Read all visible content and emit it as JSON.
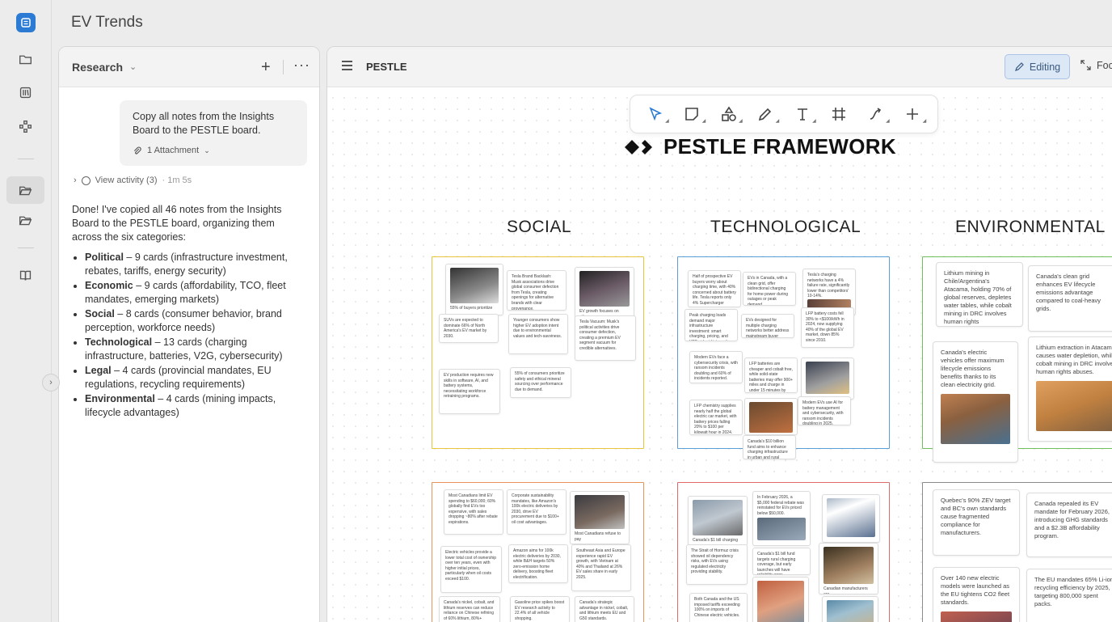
{
  "app": {
    "title": "EV Trends"
  },
  "rail": {
    "icons": [
      "folder-icon",
      "library-icon",
      "flow-icon",
      "folder-open-icon",
      "folder-open-icon",
      "book-icon"
    ]
  },
  "research": {
    "title": "Research",
    "user_message": "Copy all notes from the Insights Board to the PESTLE board.",
    "attachment": "1 Attachment",
    "activity": "View activity (3)",
    "activity_time": "· 1m 5s",
    "reply_intro": "Done! I've copied all 46 notes from the Insights Board to the PESTLE board, organizing them across the six categories:",
    "items": [
      {
        "name": "Political",
        "text": " – 9 cards (infrastructure investment, rebates, tariffs, energy security)"
      },
      {
        "name": "Economic",
        "text": " – 9 cards (affordability, TCO, fleet mandates, emerging markets)"
      },
      {
        "name": "Social",
        "text": " – 8 cards (consumer behavior, brand perception, workforce needs)"
      },
      {
        "name": "Technological",
        "text": " – 13 cards (charging infrastructure, batteries, V2G, cybersecurity)"
      },
      {
        "name": "Legal",
        "text": " – 4 cards (provincial mandates, EU regulations, recycling requirements)"
      },
      {
        "name": "Environmental",
        "text": " – 4 cards (mining impacts, lifecycle advantages)"
      }
    ]
  },
  "canvas": {
    "title": "PESTLE",
    "editing_label": "Editing",
    "focus_label": "Foc",
    "framework_title": "PESTLE FRAMEWORK",
    "categories": [
      "SOCIAL",
      "TECHNOLOGICAL",
      "ENVIRONMENTAL"
    ],
    "colors": {
      "social": "#e8c53a",
      "technological": "#5a9fd8",
      "environmental": "#6fbf5a",
      "economic": "#e8935a",
      "legal": "#e06a6a",
      "political": "#8a8a8a"
    },
    "social_cards": [
      "55% of buyers prioritize",
      "Tesla Brand Backlash: Musk associations drive global consumer defection from Tesla, creating openings for alternative brands with clear provenance.",
      "EV growth focuses on cities.",
      "SUVs are expected to dominate 66% of North America's EV market by 2030.",
      "Younger consumers show higher EV adoption intent due to environmental values and tech-savviness.",
      "Tesla Vacuum: Musk's political activities drive consumer defection, creating a premium EV segment vacuum for credible alternatives.",
      "EV production requires new skills in software, AI, and battery systems, necessitating workforce retraining programs.",
      "55% of consumers prioritize safety and ethical mineral sourcing over performance due to demand."
    ],
    "tech_cards": [
      "Half of prospective EV buyers worry about charging time, with 40% concerned about battery life. Tesla reports only 4% Supercharger issues versus competitors' 10-14%.",
      "EVs in Canada, with a clean grid, offer bidirectional charging for home power during outages or peak demand.",
      "Tesla's charging networks have a 4% failure rate, significantly lower than competitors' 10-14%.",
      "Peak charging loads demand major infrastructure investment: smart charging, pricing, and V2G aid grid integration.",
      "EVs designed for multiple charging networks better address mainstream buyer needs.",
      "LFP battery costs fell 30% to <$100/kWh in 2024, now supplying 40% of the global EV market, down 85% since 2010.",
      "Modern EVs face a cybersecurity crisis, with ransom incidents doubling and 60% of incidents reported.",
      "LFP batteries are cheaper and cobalt free, while solid-state batteries may offer 900+ miles and charge in under 15 minutes by 2027-2030.",
      "LFP chemistry supplies nearly half the global electric car market, with battery prices falling 20% to $100 per kilowatt hour in 2024.",
      "Modern EVs use AI for battery management and cybersecurity, with ransom incidents doubling in 2025.",
      "Canada's $10 billion fund aims to enhance charging infrastructure in urban and rural areas."
    ],
    "env_cards": [
      "Lithium mining in Chile/Argentina's Atacama, holding 70% of global reserves, depletes water tables, while cobalt mining in DRC involves human rights",
      "Canada's clean grid enhances EV lifecycle emissions advantage compared to coal-heavy grids.",
      "Canada's electric vehicles offer maximum lifecycle emissions benefits thanks to its clean electricity grid.",
      "Lithium extraction in Atacama causes water depletion, while cobalt mining in DRC involves human rights abuses."
    ],
    "econ_cards": [
      "Most Canadians limit EV spending to $60,000; 60% globally find EVs too expensive, with sales dropping ~80% after rebate expirations.",
      "Corporate sustainability mandates, like Amazon's 100k electric deliveries by 2030, drive EV procurement due to $100+ oil cost advantages.",
      "Most Canadians refuse to pay",
      "Electric vehicles provide a lower total cost of ownership over ten years, even with higher initial prices, particularly when oil costs exceed $100.",
      "Amazon aims for 100k electric deliveries by 2030, while B&H targets 50% zero-emission home delivery, boosting fleet electrification.",
      "Southeast Asia and Europe experience rapid EV growth, with Vietnam at 40% and Thailand at 26% EV sales share in early 2025.",
      "Canada's nickel, cobalt, and lithium reserves can reduce reliance on Chinese refining of 60% lithium, 80%+",
      "Gasoline price spikes boost EV research activity to 22.4% of all vehicle shopping.",
      "Canada's strategic advantage in nickel, cobalt, and lithium meets EU and G50 standards."
    ],
    "legal_cards": [
      "In February 2026, a $5,000 federal rebate was reinstated for EVs priced below $50,000.",
      "Canada's $1 bill charging",
      "The Strait of Hormuz crisis showed oil dependency risks, with EVs using regulated electricity providing stability.",
      "Canada's $1 bill fund targets rural charging coverage, but early launches will have reliability gaps.",
      "Canadian manufacturers are",
      "Both Canada and the US imposed tariffs exceeding 100% on imports of Chinese electric vehicles."
    ],
    "pol_cards": [
      "Quebec's 90% ZEV target and BC's own standards cause fragmented compliance for manufacturers.",
      "Canada repealed its EV mandate for February 2026, introducing GHG standards and a $2.3B affordability program.",
      "Over 140 new electric models were launched as the EU tightens CO2 fleet standards.",
      "The EU mandates 65% Li-ion recycling efficiency by 2025, targeting 800,000 spent packs."
    ]
  }
}
